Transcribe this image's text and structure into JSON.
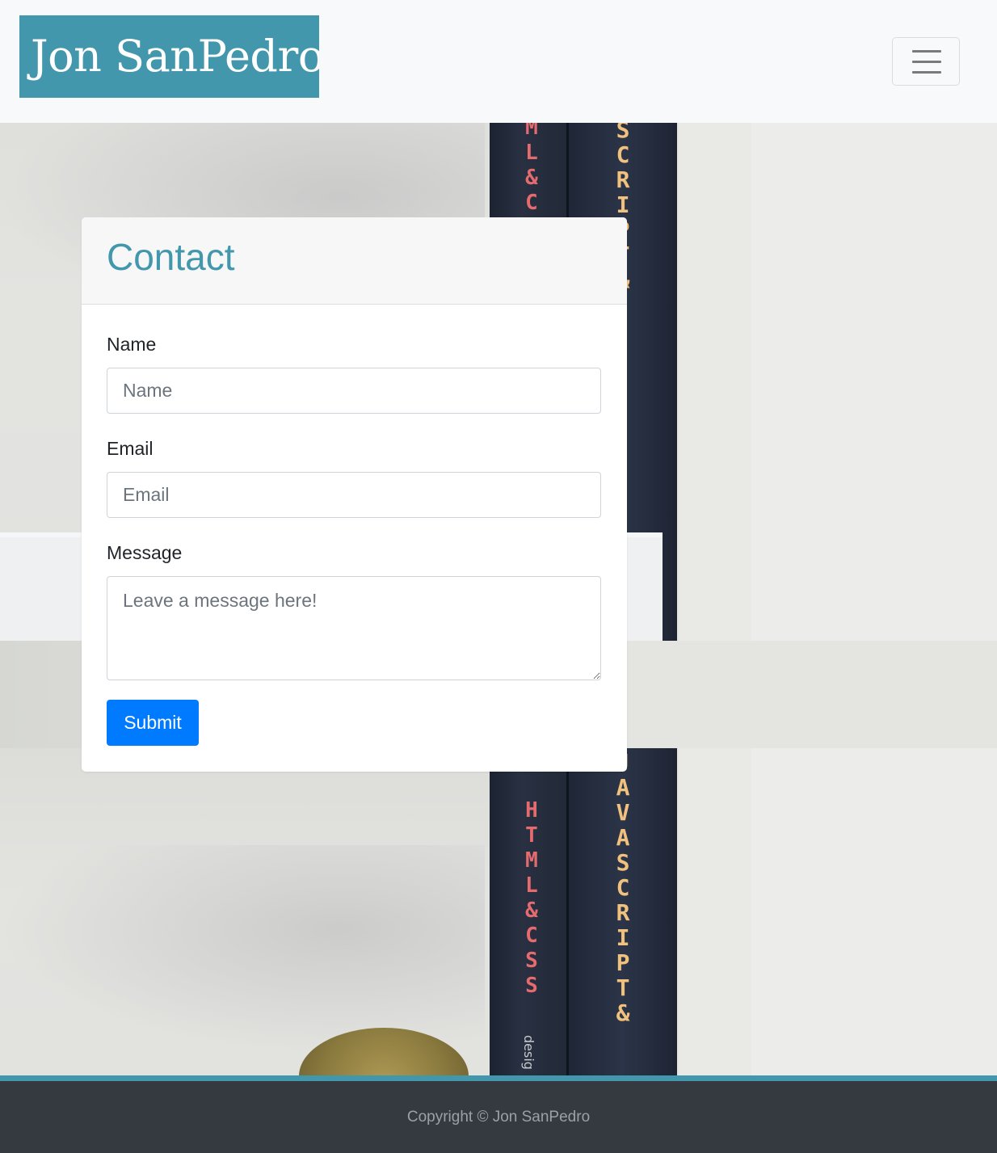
{
  "navbar": {
    "brand": "Jon SanPedro",
    "toggler_icon": "hamburger-menu-icon"
  },
  "background": {
    "book_spines": [
      "HTML&CSS",
      "JAVASCRIPT&"
    ],
    "book_small_text": "desig"
  },
  "contact": {
    "title": "Contact",
    "fields": {
      "name": {
        "label": "Name",
        "placeholder": "Name"
      },
      "email": {
        "label": "Email",
        "placeholder": "Email"
      },
      "message": {
        "label": "Message",
        "placeholder": "Leave a message here!"
      }
    },
    "submit_label": "Submit"
  },
  "footer": {
    "copyright": "Copyright © Jon SanPedro"
  },
  "colors": {
    "accent": "#4297ad",
    "primary_button": "#007bff",
    "footer_bg": "#343a40"
  }
}
